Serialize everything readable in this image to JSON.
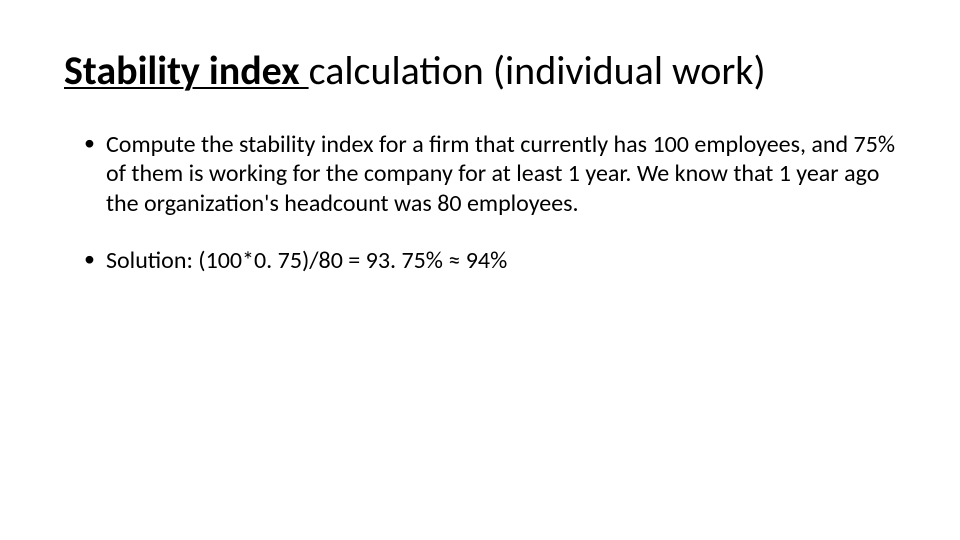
{
  "title": {
    "boldPart": "Stability index ",
    "rest": "calculation (individual work)"
  },
  "bullets": [
    "Compute the stability index for a firm that currently has 100 employees, and 75% of them is working for the company for at least 1 year. We know that 1 year ago the organization's headcount was 80 employees.",
    "Solution: (100*0. 75)/80 = 93. 75% ≈ 94%"
  ]
}
